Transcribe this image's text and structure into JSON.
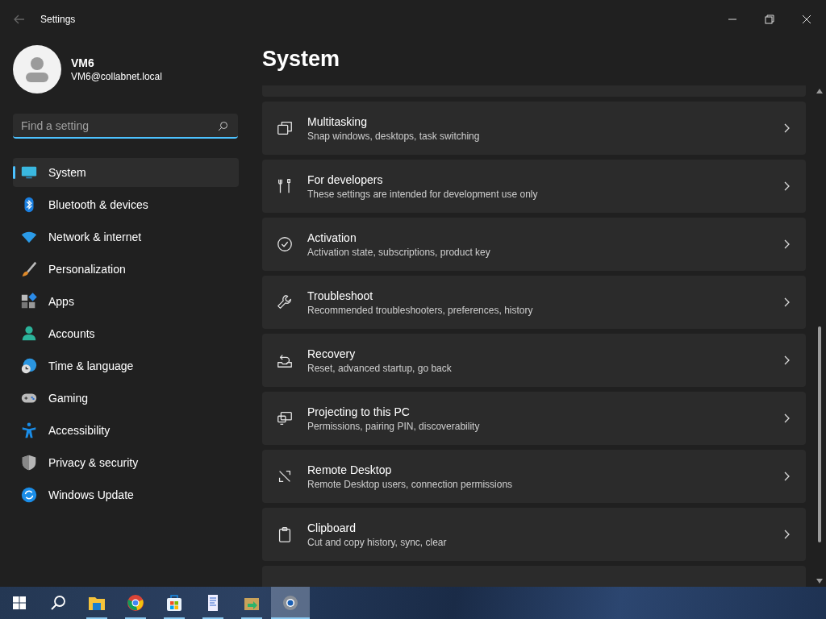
{
  "window": {
    "title": "Settings"
  },
  "profile": {
    "name": "VM6",
    "email": "VM6@collabnet.local"
  },
  "search": {
    "placeholder": "Find a setting"
  },
  "sidebar": {
    "items": [
      {
        "label": "System",
        "selected": true
      },
      {
        "label": "Bluetooth & devices",
        "selected": false
      },
      {
        "label": "Network & internet",
        "selected": false
      },
      {
        "label": "Personalization",
        "selected": false
      },
      {
        "label": "Apps",
        "selected": false
      },
      {
        "label": "Accounts",
        "selected": false
      },
      {
        "label": "Time & language",
        "selected": false
      },
      {
        "label": "Gaming",
        "selected": false
      },
      {
        "label": "Accessibility",
        "selected": false
      },
      {
        "label": "Privacy & security",
        "selected": false
      },
      {
        "label": "Windows Update",
        "selected": false
      }
    ]
  },
  "page": {
    "title": "System",
    "items": [
      {
        "title": "Multitasking",
        "subtitle": "Snap windows, desktops, task switching"
      },
      {
        "title": "For developers",
        "subtitle": "These settings are intended for development use only"
      },
      {
        "title": "Activation",
        "subtitle": "Activation state, subscriptions, product key"
      },
      {
        "title": "Troubleshoot",
        "subtitle": "Recommended troubleshooters, preferences, history"
      },
      {
        "title": "Recovery",
        "subtitle": "Reset, advanced startup, go back"
      },
      {
        "title": "Projecting to this PC",
        "subtitle": "Permissions, pairing PIN, discoverability"
      },
      {
        "title": "Remote Desktop",
        "subtitle": "Remote Desktop users, connection permissions"
      },
      {
        "title": "Clipboard",
        "subtitle": "Cut and copy history, sync, clear"
      }
    ]
  },
  "taskbar": {
    "items": [
      {
        "running": false,
        "selected": false
      },
      {
        "running": false,
        "selected": false
      },
      {
        "running": true,
        "selected": false
      },
      {
        "running": true,
        "selected": false
      },
      {
        "running": true,
        "selected": false
      },
      {
        "running": true,
        "selected": false
      },
      {
        "running": true,
        "selected": false
      },
      {
        "running": true,
        "selected": true
      }
    ]
  }
}
